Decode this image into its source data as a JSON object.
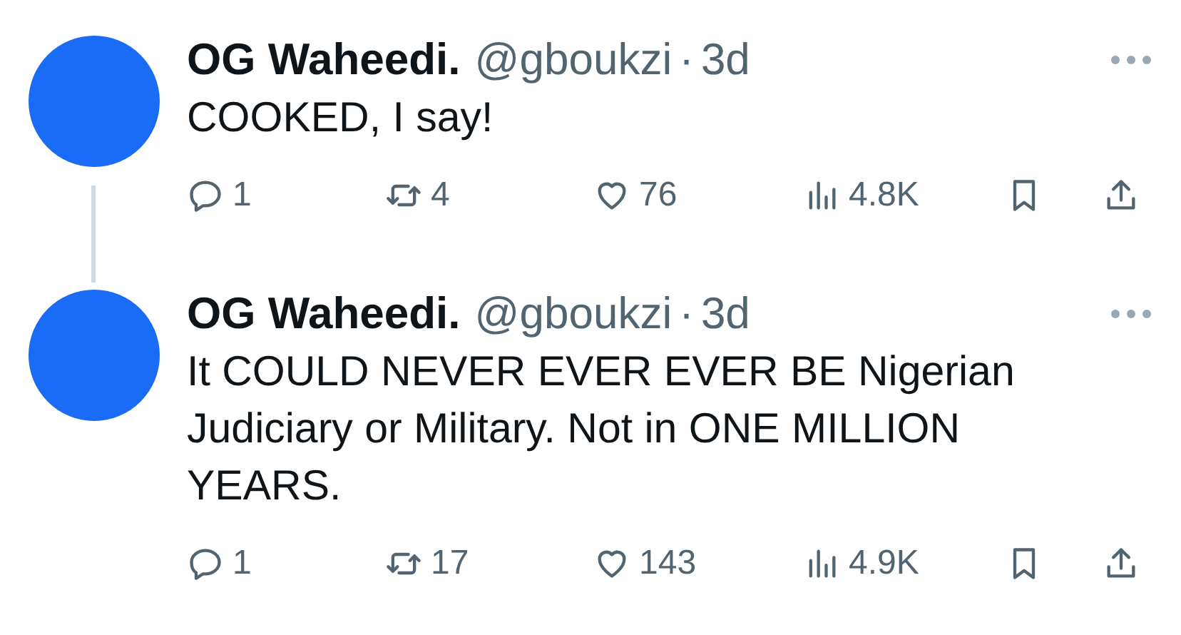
{
  "tweets": [
    {
      "name": "OG Waheedi.",
      "handle": "@gboukzi",
      "separator": "·",
      "time": "3d",
      "text": "COOKED, I say!",
      "thread_continues": true,
      "stats": {
        "replies": "1",
        "reposts": "4",
        "likes": "76",
        "views": "4.8K"
      }
    },
    {
      "name": "OG Waheedi.",
      "handle": "@gboukzi",
      "separator": "·",
      "time": "3d",
      "text": "It COULD NEVER EVER EVER BE Nigerian Judiciary or Military. Not in ONE MILLION YEARS.",
      "thread_continues": false,
      "stats": {
        "replies": "1",
        "reposts": "17",
        "likes": "143",
        "views": "4.9K"
      }
    }
  ]
}
